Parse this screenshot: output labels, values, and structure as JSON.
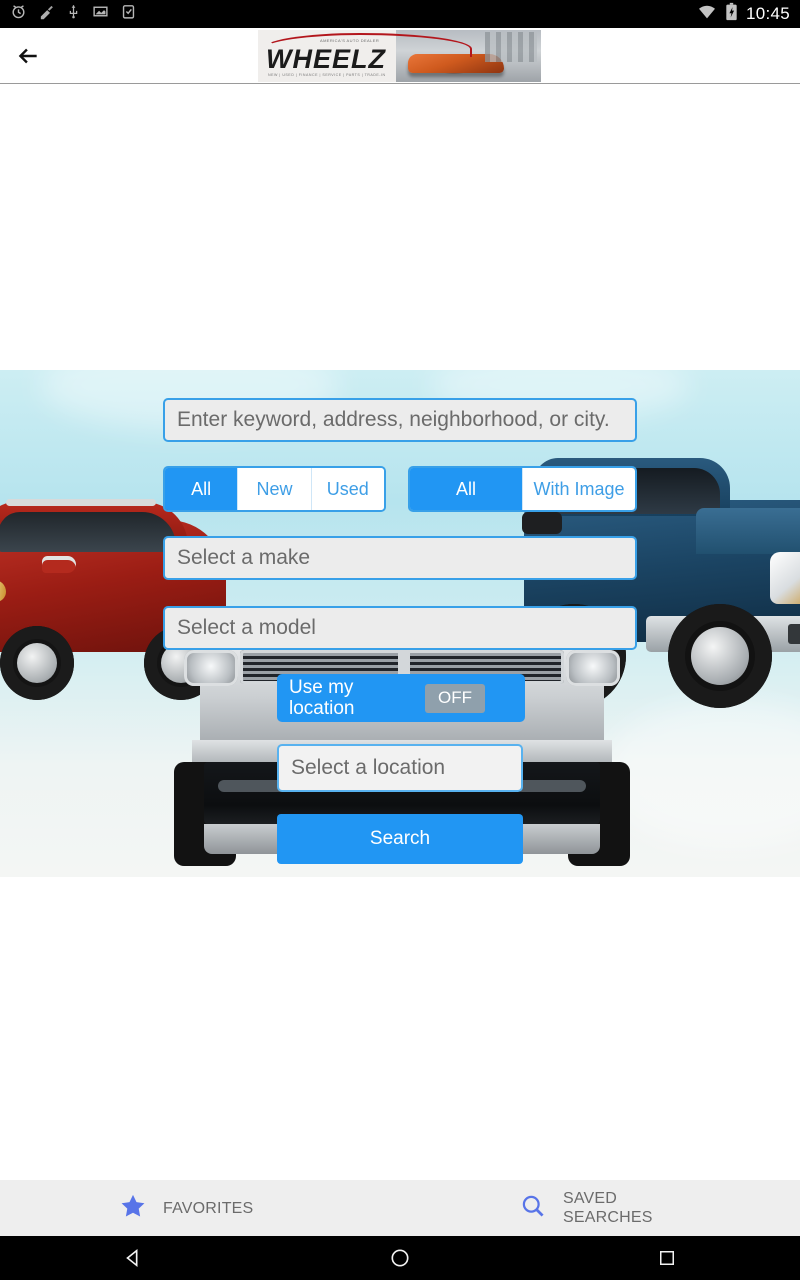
{
  "status_bar": {
    "time": "10:45",
    "left_icons": [
      "alarm-icon",
      "broom-icon",
      "usb-icon",
      "screenshot-icon",
      "clipboard-icon"
    ],
    "right_icons": [
      "wifi-icon",
      "battery-charging-icon"
    ]
  },
  "app_bar": {
    "back_icon": "back-arrow-icon",
    "logo": {
      "wordmark": "WHEELZ",
      "tagline_top": "AMERICA'S AUTO DEALER",
      "tagline_bottom": "NEW | USED | FINANCE | SERVICE | PARTS | TRADE-IN"
    }
  },
  "hero": {
    "keyword_placeholder": "Enter keyword, address, neighborhood, or city.",
    "keyword_value": "",
    "condition_options": [
      {
        "label": "All",
        "selected": true
      },
      {
        "label": "New",
        "selected": false
      },
      {
        "label": "Used",
        "selected": false
      }
    ],
    "image_options": [
      {
        "label": "All",
        "selected": true
      },
      {
        "label": "With Image",
        "selected": false
      }
    ],
    "make_placeholder": "Select a make",
    "make_value": "",
    "model_placeholder": "Select a model",
    "model_value": "",
    "use_location_label": "Use my location",
    "use_location_state": "OFF",
    "location_placeholder": "Select a location",
    "location_value": "",
    "search_label": "Search"
  },
  "tab_bar": {
    "tabs": [
      {
        "label": "FAVORITES",
        "icon": "star-icon"
      },
      {
        "label": "SAVED SEARCHES",
        "icon": "search-icon"
      }
    ]
  },
  "nav_bar": {
    "buttons": [
      "back-triangle-icon",
      "home-circle-icon",
      "recents-square-icon"
    ]
  },
  "colors": {
    "accent_blue": "#2196f3",
    "field_border": "#38a0e8",
    "field_fill": "#ececec",
    "tab_icon_blue": "#5874e8",
    "hero_sky": "#b6e4ee",
    "tab_bar_bg": "#eeeeee"
  }
}
